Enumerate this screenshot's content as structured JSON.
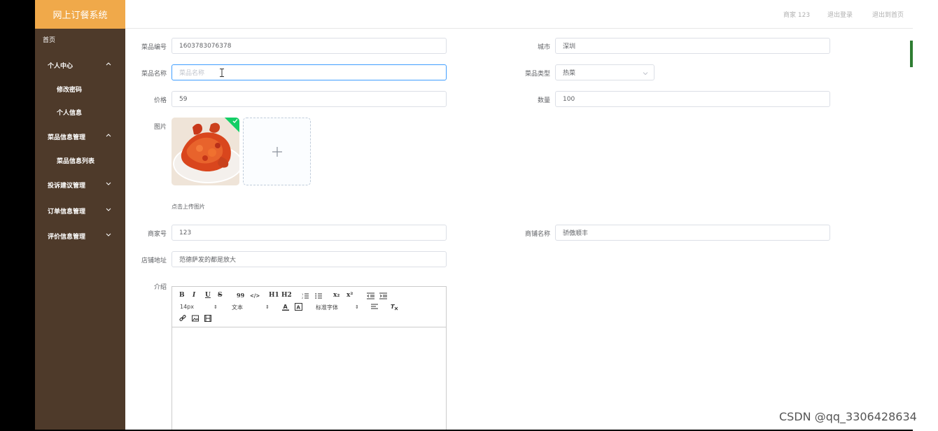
{
  "app": {
    "title": "网上订餐系统"
  },
  "topbar": {
    "user": "商家 123",
    "logout": "退出登录",
    "exit_home": "退出到首页"
  },
  "sidebar": {
    "items": [
      {
        "label": "首页"
      },
      {
        "label": "个人中心",
        "expanded": true
      },
      {
        "label": "修改密码"
      },
      {
        "label": "个人信息"
      },
      {
        "label": "菜品信息管理",
        "expanded": true
      },
      {
        "label": "菜品信息列表"
      },
      {
        "label": "投诉建议管理",
        "expanded": false
      },
      {
        "label": "订单信息管理",
        "expanded": false
      },
      {
        "label": "评价信息管理",
        "expanded": false
      }
    ]
  },
  "form": {
    "dish_code": {
      "label": "菜品编号",
      "value": "1603783076378"
    },
    "city": {
      "label": "城市",
      "value": "深圳"
    },
    "dish_name": {
      "label": "菜品名称",
      "placeholder": "菜品名称"
    },
    "dish_type": {
      "label": "菜品类型",
      "value": "热菜"
    },
    "price": {
      "label": "价格",
      "value": "59"
    },
    "quantity": {
      "label": "数量",
      "value": "100"
    },
    "image": {
      "label": "图片",
      "upload_tip": "点击上传图片"
    },
    "merchant_no": {
      "label": "商家号",
      "value": "123"
    },
    "shop_name": {
      "label": "商铺名称",
      "value": "骄傲顺丰"
    },
    "shop_address": {
      "label": "店铺地址",
      "value": "范德萨发的都是放大"
    },
    "intro": {
      "label": "介绍"
    }
  },
  "editor": {
    "font_size": "14px",
    "block_type": "文本",
    "font_family": "标准字体",
    "buttons": [
      "B",
      "I",
      "U",
      "S",
      "99",
      "</>",
      "H1",
      "H2",
      "x₂",
      "x²"
    ]
  },
  "watermark": "CSDN @qq_3306428634",
  "colors": {
    "logo_bg": "#f0a94a",
    "sidebar_bg": "#4e3a2a",
    "focus_border": "#409eff",
    "success_badge": "#13ce66"
  }
}
